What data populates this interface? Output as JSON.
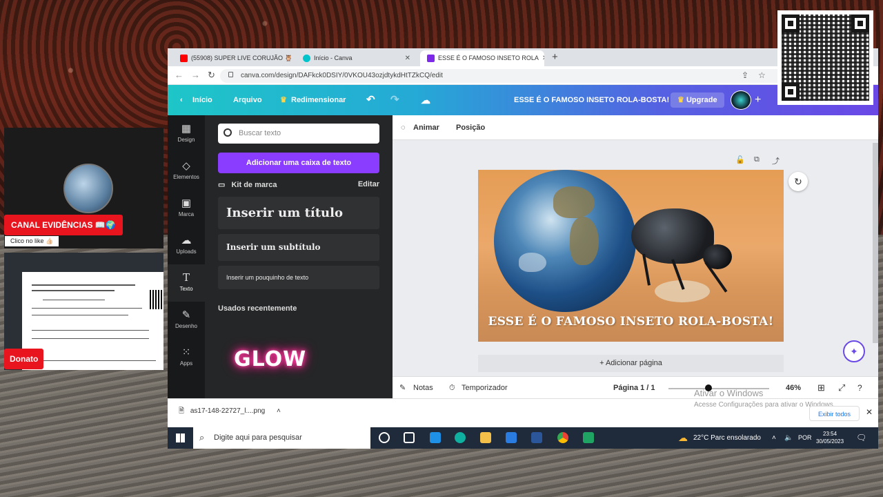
{
  "overlay": {
    "channel_label": "CANAL EVIDÊNCIAS 📖🌍",
    "like_label": "Clico no like 👍🏻",
    "donate_label": "Donato"
  },
  "browser": {
    "tabs": [
      {
        "label": "(55908) SUPER LIVE CORUJÃO 🦉",
        "icon": "youtube-icon"
      },
      {
        "label": "Início - Canva",
        "icon": "canva-icon"
      },
      {
        "label": "ESSE É O FAMOSO INSETO ROLA",
        "icon": "canva-doc-icon"
      }
    ],
    "url": "canva.com/design/DAFkck0DSIY/0VKOU43ozjdtykdHtTZkCQ/edit"
  },
  "canva": {
    "topbar": {
      "home": "Início",
      "file": "Arquivo",
      "resize": "Redimensionar",
      "doc_title": "ESSE É O FAMOSO INSETO ROLA-BOSTA!",
      "upgrade": "Upgrade"
    },
    "rail": [
      {
        "label": "Design",
        "icon": "▦"
      },
      {
        "label": "Elementos",
        "icon": "◇"
      },
      {
        "label": "Marca",
        "icon": "▣"
      },
      {
        "label": "Uploads",
        "icon": "☁"
      },
      {
        "label": "Texto",
        "icon": "T"
      },
      {
        "label": "Desenho",
        "icon": "✎"
      },
      {
        "label": "Apps",
        "icon": "⁙"
      }
    ],
    "panel": {
      "search_placeholder": "Buscar texto",
      "add_textbox": "Adicionar uma caixa de texto",
      "brand_kit": "Kit de marca",
      "edit": "Editar",
      "heading": "Inserir um título",
      "subheading": "Inserir um subtítulo",
      "body": "Inserir um pouquinho de texto",
      "recent": "Usados recentemente",
      "glow": "GLOW"
    },
    "context_bar": {
      "animate": "Animar",
      "position": "Posição"
    },
    "design_caption": "ESSE É O FAMOSO INSETO ROLA-BOSTA!",
    "add_page": "+ Adicionar página",
    "footer": {
      "notes": "Notas",
      "timer": "Temporizador",
      "page": "Página 1 / 1",
      "zoom": "46%",
      "zoom_fraction": 0.4
    }
  },
  "downloads": {
    "file": "as17-148-22727_l....png",
    "show_all": "Exibir todos",
    "activate_title": "Ativar o Windows",
    "activate_sub": "Acesse Configurações para ativar o Windows."
  },
  "taskbar": {
    "search_placeholder": "Digite aqui para pesquisar",
    "weather": "22°C  Parc ensolarado",
    "lang": "POR",
    "time": "23:54",
    "date": "30/05/2023"
  },
  "colors": {
    "canva_purple": "#8b3dff",
    "live_red": "#e8141e"
  }
}
